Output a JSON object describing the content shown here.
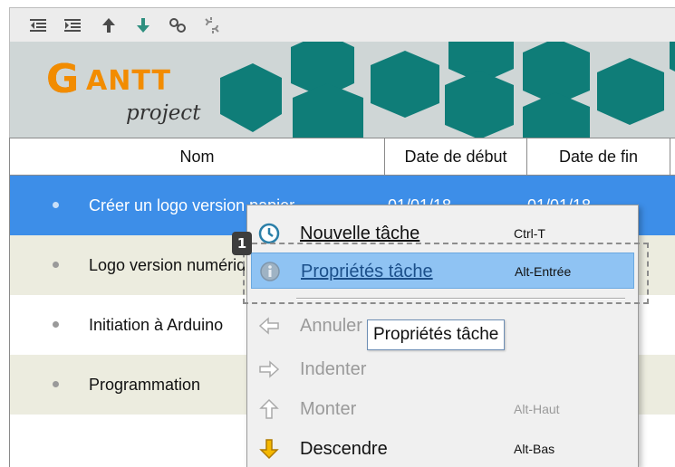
{
  "toolbar": {
    "buttons": [
      "outdent-icon",
      "indent-icon",
      "move-up-icon",
      "move-down-icon",
      "link-icon",
      "unlink-icon"
    ]
  },
  "logo": {
    "g": "G",
    "antt": "ANTT",
    "project": "project"
  },
  "table": {
    "headers": {
      "name": "Nom",
      "start": "Date de début",
      "end": "Date de fin"
    },
    "rows": [
      {
        "name": "Créer un logo version papier",
        "start": "01/01/18",
        "end": "01/01/18"
      },
      {
        "name": "Logo version numérique",
        "start": "",
        "end": ""
      },
      {
        "name": "Initiation à Arduino",
        "start": "",
        "end": ""
      },
      {
        "name": "Programmation",
        "start": "",
        "end": ""
      }
    ]
  },
  "menu": {
    "items": [
      {
        "label": "Nouvelle tâche",
        "shortcut": "Ctrl-T",
        "enabled": true
      },
      {
        "label": "Propriétés tâche",
        "shortcut": "Alt-Entrée",
        "enabled": true,
        "highlighted": true
      },
      {
        "label": "Annuler",
        "shortcut": "",
        "enabled": false
      },
      {
        "label": "Indenter",
        "shortcut": "",
        "enabled": false
      },
      {
        "label": "Monter",
        "shortcut": "Alt-Haut",
        "enabled": false
      },
      {
        "label": "Descendre",
        "shortcut": "Alt-Bas",
        "enabled": true
      }
    ]
  },
  "badge": "1",
  "tooltip": "Propriétés tâche",
  "colors": {
    "selection": "#3d8ee8",
    "row_alt": "#ececdf",
    "menu_highlight": "#8fc3f3",
    "logo_orange": "#f28c00"
  }
}
